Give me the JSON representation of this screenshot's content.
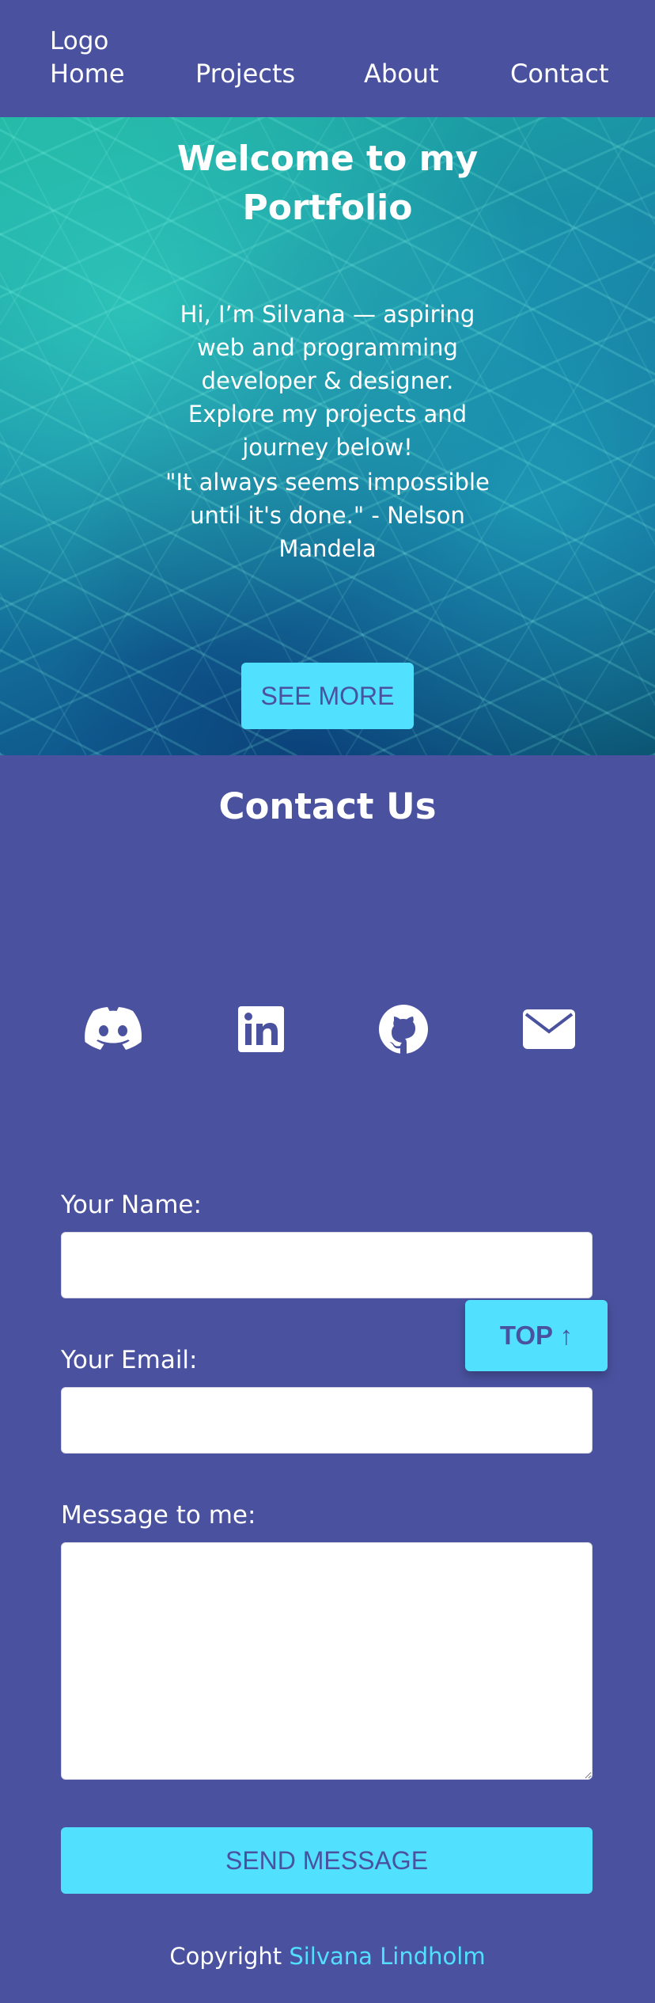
{
  "nav": {
    "logo": "Logo",
    "links": [
      "Home",
      "Projects",
      "About",
      "Contact"
    ]
  },
  "hero": {
    "title": "Welcome to my Portfolio",
    "intro": "Hi, I’m Silvana — aspiring web and programming developer & designer. Explore my projects and journey below!",
    "quote": "\"It always seems impossible until it's done.\" - Nelson Mandela",
    "see_more_label": "SEE MORE"
  },
  "contact": {
    "title": "Contact Us",
    "socials": [
      "discord-icon",
      "linkedin-icon",
      "github-icon",
      "email-icon"
    ],
    "name_label": "Your Name:",
    "email_label": "Your Email:",
    "message_label": "Message to me:",
    "name_value": "",
    "email_value": "",
    "message_value": "",
    "send_label": "SEND MESSAGE"
  },
  "top_button_label": "TOP ↑",
  "footer": {
    "prefix": "Copyright",
    "name": "Silvana Lindholm"
  },
  "colors": {
    "background": "#4a52a0",
    "accent": "#52e0ff",
    "text": "#ffffff"
  }
}
